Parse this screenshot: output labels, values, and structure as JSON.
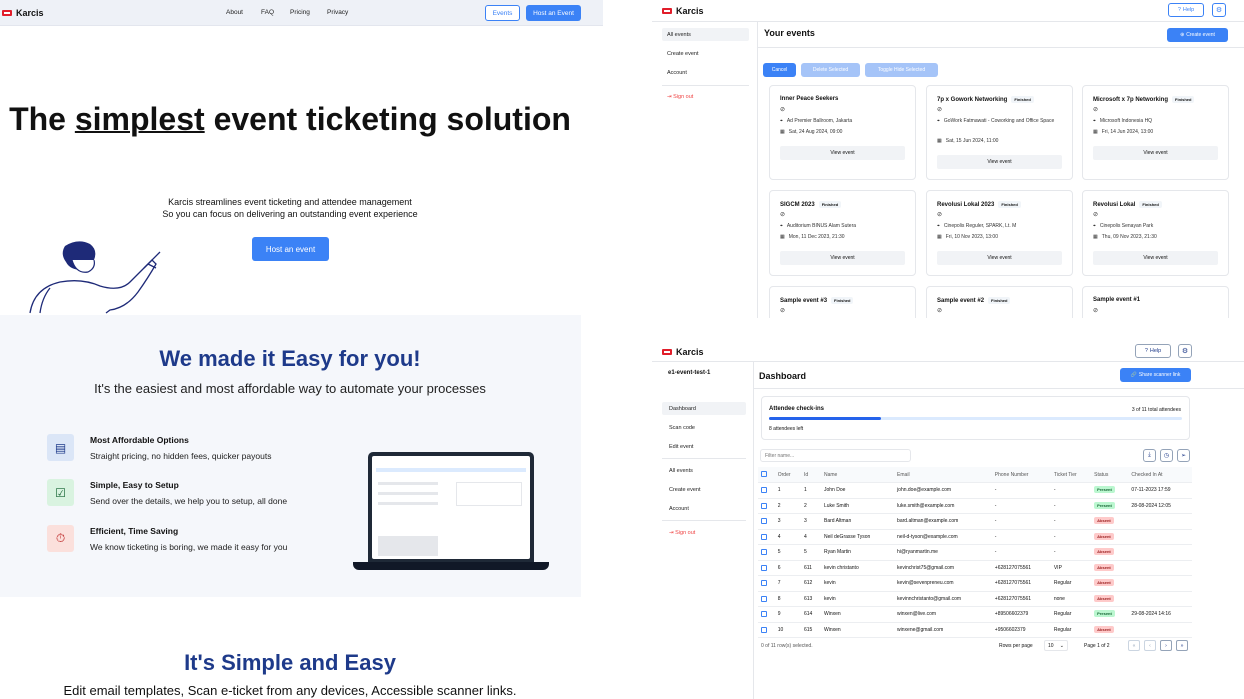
{
  "landing": {
    "brand": "Karcis",
    "nav": [
      "About",
      "FAQ",
      "Pricing",
      "Privacy"
    ],
    "events_btn": "Events",
    "host_btn": "Host an Event",
    "title_pre": "The ",
    "title_u": "simplest",
    "title_post": " event ticketing solution",
    "sub1": "Karcis streamlines event ticketing and attendee management",
    "sub2": "So you can focus on delivering an outstanding event experience",
    "hero_btn": "Host an event",
    "easy_title": "We made it Easy for you!",
    "easy_sub": "It's the easiest and most affordable way to automate your processes",
    "features": [
      {
        "title": "Most Affordable Options",
        "desc": "Straight pricing, no hidden fees, quicker payouts",
        "icon": "money-icon",
        "color": "#dbe6f7"
      },
      {
        "title": "Simple, Easy to Setup",
        "desc": "Send over the details, we help you to setup, all done",
        "icon": "check-icon",
        "color": "#d9f3e0"
      },
      {
        "title": "Efficient, Time Saving",
        "desc": "We know ticketing is boring, we made it easy for you",
        "icon": "stopwatch-icon",
        "color": "#fbe0dc"
      }
    ],
    "simple_title": "It's Simple and Easy",
    "simple_sub": "Edit email templates, Scan e-ticket from any devices, Accessible scanner links."
  },
  "events": {
    "brand": "Karcis",
    "help": "Help",
    "sidebar": [
      "All events",
      "Create event",
      "Account"
    ],
    "signout": "Sign out",
    "heading": "Your events",
    "create_btn": "Create event",
    "cancel": "Cancel",
    "delete_sel": "Delete Selected",
    "toggle_hide": "Toggle Hide Selected",
    "view": "View event",
    "badge": "Finished",
    "cards": [
      {
        "title": "Inner Peace Seekers",
        "finished": false,
        "loc": "Ad Premier Ballroom, Jakarta",
        "date": "Sat, 24 Aug 2024, 09:00"
      },
      {
        "title": "7p x Gowork Networking",
        "finished": true,
        "loc": "GoWork Fatmawati - Coworking and Office Space",
        "date": "Sat, 15 Jun 2024, 11:00"
      },
      {
        "title": "Microsoft x 7p Networking",
        "finished": true,
        "loc": "Microsoft Indonesia HQ",
        "date": "Fri, 14 Jun 2024, 13:00"
      },
      {
        "title": "SIGCM 2023",
        "finished": true,
        "loc": "Auditorium BINUS Alam Sutera",
        "date": "Mon, 11 Dec 2023, 21:30"
      },
      {
        "title": "Revolusi Lokal 2023",
        "finished": true,
        "loc": "Cinepolis Reguler, SPARK, Lt. M",
        "date": "Fri, 10 Nov 2023, 13:00"
      },
      {
        "title": "Revolusi Lokal",
        "finished": true,
        "loc": "Cinepolis Senayan Park",
        "date": "Thu, 09 Nov 2023, 21:30"
      },
      {
        "title": "Sample event #3",
        "finished": true
      },
      {
        "title": "Sample event #2",
        "finished": true
      },
      {
        "title": "Sample event #1",
        "finished": false
      }
    ]
  },
  "dash": {
    "brand": "Karcis",
    "help": "Help",
    "event_id": "e1-event-test-1",
    "sidebar1": [
      "Dashboard",
      "Scan code",
      "Edit event"
    ],
    "sidebar2": [
      "All events",
      "Create event",
      "Account"
    ],
    "signout": "Sign out",
    "heading": "Dashboard",
    "share_btn": "Share scanner link",
    "checkins_title": "Attendee check-ins",
    "checkins_total": "3 of 11 total attendees",
    "checkins_left": "8 attendees left",
    "checkins_progress": 0.27,
    "filter_placeholder": "Filter name...",
    "columns": [
      "Order",
      "Id",
      "Name",
      "Email",
      "Phone Number",
      "Ticket Tier",
      "Status",
      "Checked In At"
    ],
    "rows": [
      [
        "1",
        "1",
        "John Doe",
        "john.doe@example.com",
        "-",
        "-",
        "Present",
        "07-11-2023 17:59"
      ],
      [
        "2",
        "2",
        "Luke Smith",
        "luke.smith@example.com",
        "-",
        "-",
        "Present",
        "28-08-2024 12:05"
      ],
      [
        "3",
        "3",
        "Bard Altman",
        "bard.altman@example.com",
        "-",
        "-",
        "Absent",
        ""
      ],
      [
        "4",
        "4",
        "Neil deGrasse Tyson",
        "neil-d-tyson@example.com",
        "-",
        "-",
        "Absent",
        ""
      ],
      [
        "5",
        "5",
        "Ryan Martin",
        "hi@ryanmartin.me",
        "-",
        "-",
        "Absent",
        ""
      ],
      [
        "6",
        "611",
        "kevin christanto",
        "kevinchrist75@gmail.com",
        "+628127075561",
        "VIP",
        "Absent",
        ""
      ],
      [
        "7",
        "612",
        "kevin",
        "kevin@sevenpreneu.com",
        "+628127075561",
        "Regular",
        "Absent",
        ""
      ],
      [
        "8",
        "613",
        "kevin",
        "kevinnchristanto@gmail.com",
        "+628127075561",
        "none",
        "Absent",
        ""
      ],
      [
        "9",
        "614",
        "Winxen",
        "winxen@live.com",
        "+89506602379",
        "Regular",
        "Present",
        "29-08-2024 14:16"
      ],
      [
        "10",
        "615",
        "Winxen",
        "winxene@gmail.com",
        "+9506602379",
        "Regular",
        "Absent",
        ""
      ]
    ],
    "selected_text": "0 of 11 row(s) selected.",
    "rows_per_page_label": "Rows per page",
    "rows_per_page": "10",
    "page_text": "Page 1 of 2"
  }
}
